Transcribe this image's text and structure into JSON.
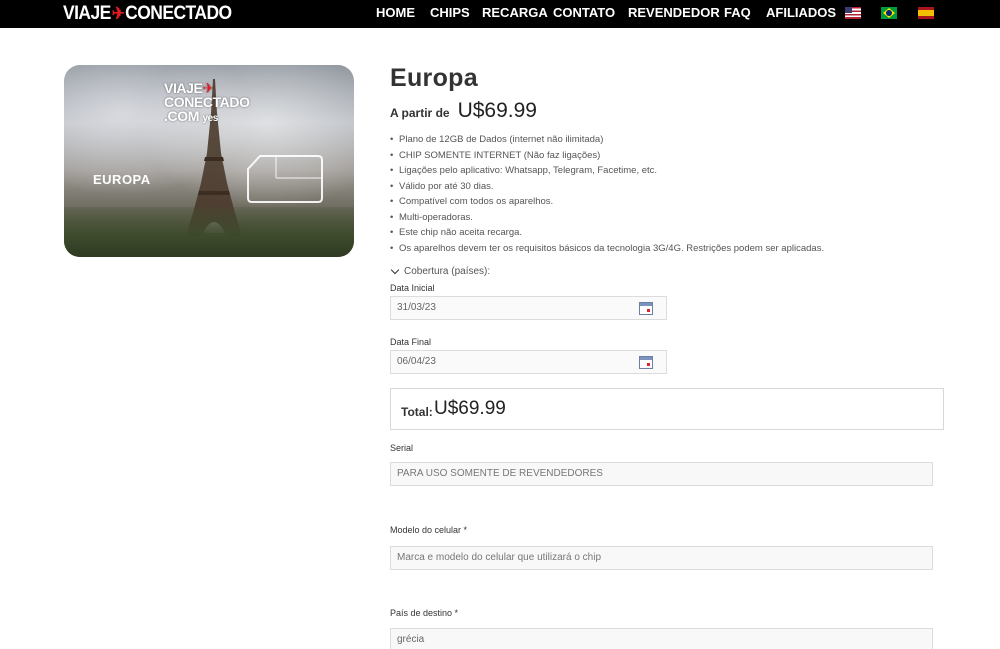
{
  "header": {
    "logo": {
      "left": "VIAJE",
      "right": "CONECTADO"
    },
    "nav": [
      "HOME",
      "CHIPS",
      "RECARGA",
      "CONTATO",
      "REVENDEDOR",
      "FAQ",
      "AFILIADOS"
    ],
    "flags": [
      "us-flag",
      "br-flag",
      "es-flag"
    ]
  },
  "product_image": {
    "logo_line1": "VIAJE",
    "logo_line2": "CONECTADO",
    "logo_line3": ".COM",
    "logo_yes": "yes",
    "region": "EUROPA"
  },
  "product": {
    "title": "Europa",
    "price_prefix": "A partir de",
    "price": "U$69.99",
    "features": [
      "Plano de 12GB de Dados (internet não ilimitada)",
      "CHIP SOMENTE INTERNET (Não faz ligações)",
      "Ligações pelo aplicativo: Whatsapp, Telegram, Facetime, etc.",
      "Válido por até 30 dias.",
      "Compatível com todos os aparelhos.",
      "Multi-operadoras.",
      "Este chip não aceita recarga.",
      "Os aparelhos devem ter os requisitos básicos da tecnologia 3G/4G. Restrições podem ser aplicadas."
    ],
    "coverage_label": "Cobertura (países):"
  },
  "form": {
    "start_date": {
      "label": "Data Inicial",
      "value": "31/03/23"
    },
    "end_date": {
      "label": "Data Final",
      "value": "06/04/23"
    },
    "total": {
      "label": "Total:",
      "value": "U$69.99"
    },
    "serial": {
      "label": "Serial",
      "placeholder": "PARA USO SOMENTE DE REVENDEDORES"
    },
    "phone_model": {
      "label": "Modelo do celular *",
      "placeholder": "Marca e modelo do celular que utilizará o chip"
    },
    "destination": {
      "label": "País de destino *",
      "value": "grécia"
    }
  }
}
